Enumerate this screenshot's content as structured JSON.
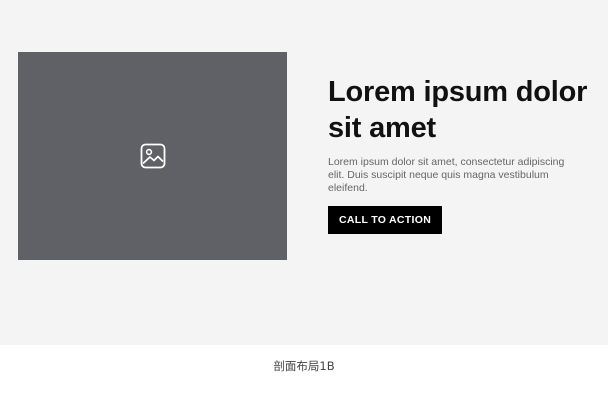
{
  "section": {
    "image_icon": "image-icon",
    "headline": "Lorem ipsum dolor sit amet",
    "body": "Lorem ipsum dolor sit amet, consectetur adipiscing elit. Duis suscipit neque quis magna vestibulum eleifend.",
    "cta_label": "CALL TO ACTION"
  },
  "caption": "剖面布局1B",
  "colors": {
    "section_background": "#f4f4f4",
    "placeholder": "#5f6166",
    "button": "#000000",
    "button_text": "#ffffff"
  }
}
